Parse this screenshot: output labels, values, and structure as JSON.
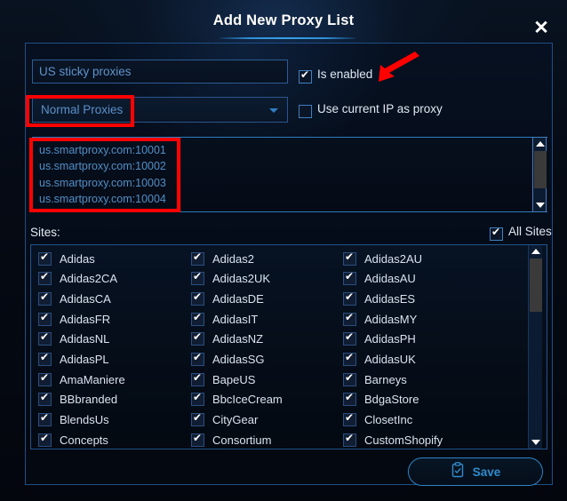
{
  "window": {
    "title": "Add New Proxy List",
    "close_icon": "close-x-icon"
  },
  "form": {
    "name_field": {
      "value": "US sticky proxies",
      "placeholder": "US sticky proxies"
    },
    "proxy_type": {
      "selected": "Normal Proxies",
      "caret_icon": "chevron-down-icon"
    },
    "is_enabled": {
      "label": "Is enabled",
      "checked": true
    },
    "use_current_ip": {
      "label": "Use current IP as proxy",
      "checked": false
    },
    "proxy_list": {
      "lines": [
        "us.smartproxy.com:10001",
        "us.smartproxy.com:10002",
        "us.smartproxy.com:10003",
        "us.smartproxy.com:10004"
      ]
    }
  },
  "sites": {
    "label": "Sites:",
    "all_sites": {
      "label": "All Sites",
      "checked": true
    },
    "columns": [
      [
        "Adidas",
        "Adidas2CA",
        "AdidasCA",
        "AdidasFR",
        "AdidasNL",
        "AdidasPL",
        "AmaManiere",
        "BBbranded",
        "BlendsUs",
        "Concepts"
      ],
      [
        "Adidas2",
        "Adidas2UK",
        "AdidasDE",
        "AdidasIT",
        "AdidasNZ",
        "AdidasSG",
        "BapeUS",
        "BbcIceCream",
        "CityGear",
        "Consortium"
      ],
      [
        "Adidas2AU",
        "AdidasAU",
        "AdidasES",
        "AdidasMY",
        "AdidasPH",
        "AdidasUK",
        "Barneys",
        "BdgaStore",
        "ClosetInc",
        "CustomShopify"
      ]
    ]
  },
  "footer": {
    "save_label": "Save",
    "save_icon": "clipboard-check-icon"
  },
  "annotations": {
    "arrow_icon": "red-arrow-icon",
    "highlight_color": "#fe0000"
  },
  "theme": {
    "accent": "#2e8ccd",
    "panel_border": "#1d4f86",
    "text_primary": "#dfe8f2",
    "text_blue": "#5a90c8",
    "background": "#04060d"
  }
}
